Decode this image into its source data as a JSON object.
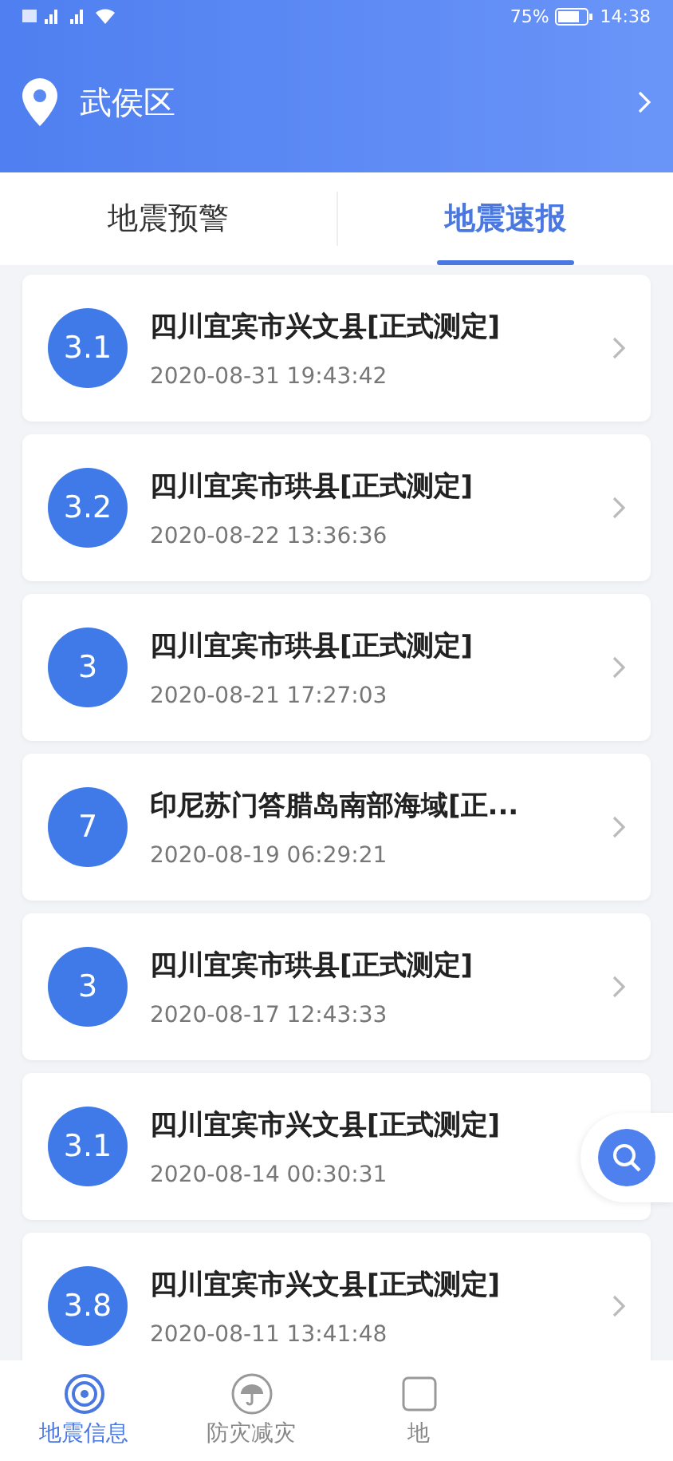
{
  "status_bar": {
    "battery": "75%",
    "time": "14:38"
  },
  "header": {
    "location": "武侯区"
  },
  "tabs": [
    {
      "label": "地震预警",
      "selected": false
    },
    {
      "label": "地震速报",
      "selected": true
    }
  ],
  "quakes": [
    {
      "magnitude": "3.1",
      "place": "四川宜宾市兴文县[正式测定]",
      "time": "2020-08-31 19:43:42"
    },
    {
      "magnitude": "3.2",
      "place": "四川宜宾市珙县[正式测定]",
      "time": "2020-08-22 13:36:36"
    },
    {
      "magnitude": "3",
      "place": "四川宜宾市珙县[正式测定]",
      "time": "2020-08-21 17:27:03"
    },
    {
      "magnitude": "7",
      "place": "印尼苏门答腊岛南部海域[正...",
      "time": "2020-08-19 06:29:21"
    },
    {
      "magnitude": "3",
      "place": "四川宜宾市珙县[正式测定]",
      "time": "2020-08-17 12:43:33"
    },
    {
      "magnitude": "3.1",
      "place": "四川宜宾市兴文县[正式测定]",
      "time": "2020-08-14 00:30:31"
    },
    {
      "magnitude": "3.8",
      "place": "四川宜宾市兴文县[正式测定]",
      "time": "2020-08-11 13:41:48"
    }
  ],
  "nav": [
    {
      "kind": "radar",
      "label": "地震信息",
      "selected": true
    },
    {
      "kind": "umbrella",
      "label": "防灾减灾",
      "selected": false
    },
    {
      "kind": "other",
      "label": "地",
      "selected": false
    }
  ]
}
